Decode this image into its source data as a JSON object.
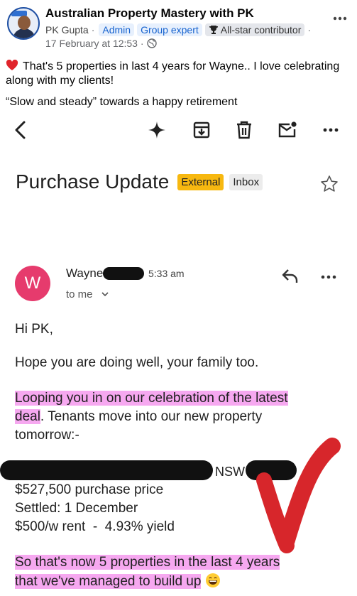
{
  "post": {
    "group_name": "Australian Property Mastery with PK",
    "author": "PK Gupta",
    "separator": "·",
    "badges": [
      "Admin",
      "Group expert",
      "All-star contributor"
    ],
    "date": "17 February at 12:53 ·",
    "text_line1": "That's 5 properties in last 4 years for Wayne.. I love celebrating along with my clients!",
    "text_line2": "“Slow and steady” towards a happy retirement"
  },
  "email": {
    "subject": "Purchase Update",
    "labels": [
      "External",
      "Inbox"
    ],
    "sender_name": "Wayne",
    "sender_initial": "W",
    "time": "5:33 am",
    "to": "to me",
    "greeting": "Hi PK,",
    "line1": "Hope you are doing well, your family too.",
    "line2a": "Looping you in on our celebration of the latest",
    "line2b": "deal",
    "line2c": ". Tenants move into our new property",
    "line3": "tomorrow:-",
    "address_state": "NSW",
    "price": "$527,500 purchase price",
    "settled": "Settled: 1 December",
    "rent": "$500/w rent  -  4.93% yield",
    "closing1": "So that's now 5 properties in the last 4 years",
    "closing2": "that we've managed to build up"
  },
  "icons": [
    "heart-icon",
    "globe-icon",
    "trophy-icon",
    "back-arrow-icon",
    "sparkle-icon",
    "archive-icon",
    "trash-icon",
    "mark-unread-icon",
    "more-icon",
    "star-icon",
    "reply-icon",
    "chevron-down-icon",
    "grinning-emoji-icon"
  ],
  "colors": {
    "highlight": "#f6a8f0",
    "external_label": "#f7b810",
    "sender_avatar": "#e63b6d",
    "admin_chip": "#1763cf",
    "annotation_arrow": "#d7262b"
  }
}
